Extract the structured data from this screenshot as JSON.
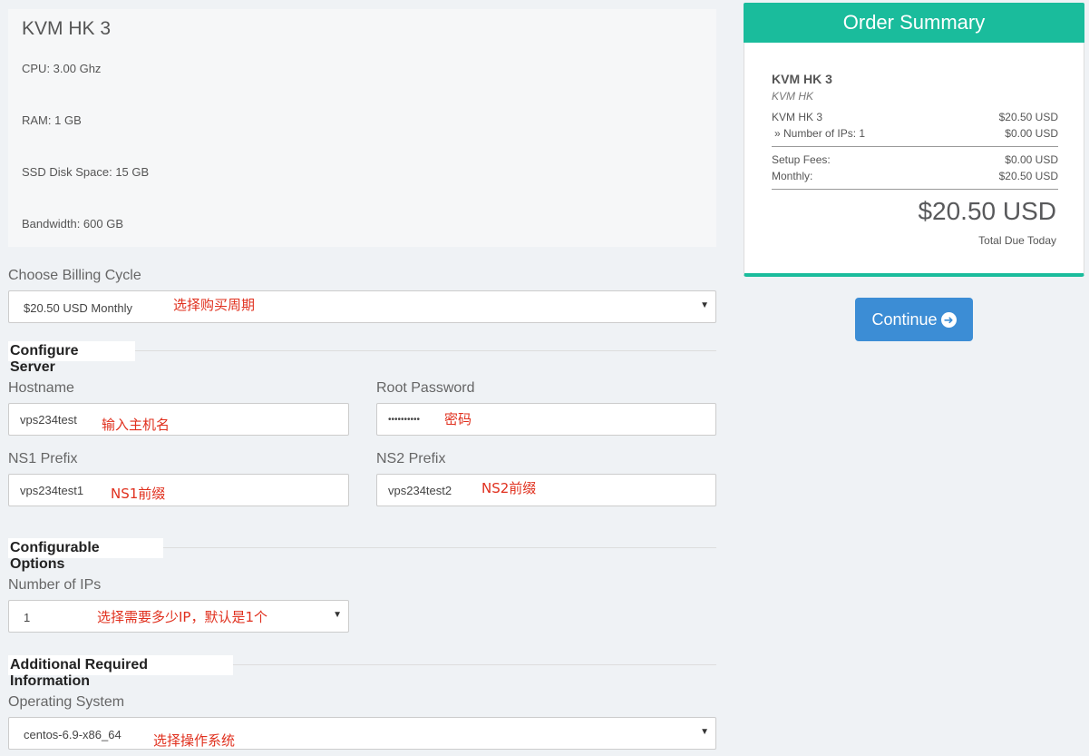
{
  "product": {
    "title": "KVM HK 3",
    "specs": [
      "CPU: 3.00 Ghz",
      "RAM: 1 GB",
      "SSD Disk Space: 15 GB",
      "Bandwidth: 600 GB"
    ]
  },
  "billing": {
    "label": "Choose Billing Cycle",
    "value": "$20.50 USD Monthly",
    "annotation": "选择购买周期"
  },
  "configure_server": {
    "title": "Configure Server",
    "hostname": {
      "label": "Hostname",
      "value": "vps234test",
      "annotation": "输入主机名"
    },
    "root_password": {
      "label": "Root Password",
      "value": "••••••••••",
      "annotation": "密码"
    },
    "ns1": {
      "label": "NS1 Prefix",
      "value": "vps234test1",
      "annotation": "NS1前缀"
    },
    "ns2": {
      "label": "NS2 Prefix",
      "value": "vps234test2",
      "annotation": "NS2前缀"
    }
  },
  "configurable_options": {
    "title": "Configurable Options",
    "ips": {
      "label": "Number of IPs",
      "value": "1",
      "annotation": "选择需要多少IP，默认是1个"
    }
  },
  "additional_info": {
    "title": "Additional Required Information",
    "os": {
      "label": "Operating System",
      "value": "centos-6.9-x86_64",
      "annotation": "选择操作系统"
    }
  },
  "summary": {
    "header": "Order Summary",
    "product_name": "KVM HK 3",
    "product_group": "KVM HK",
    "lines": [
      {
        "label": "KVM HK 3",
        "amount": "$20.50 USD"
      },
      {
        "label": "» Number of IPs: 1",
        "amount": "$0.00 USD"
      }
    ],
    "setup_label": "Setup Fees:",
    "setup_amount": "$0.00 USD",
    "monthly_label": "Monthly:",
    "monthly_amount": "$20.50 USD",
    "total": "$20.50 USD",
    "total_label": "Total Due Today"
  },
  "continue_label": "Continue",
  "colors": {
    "accent": "#1abc9c",
    "button": "#3c8dd5",
    "annotation": "#e0301e"
  },
  "icons": {
    "continue": "arrow-circle-right-icon",
    "select_caret": "caret-down-icon"
  }
}
